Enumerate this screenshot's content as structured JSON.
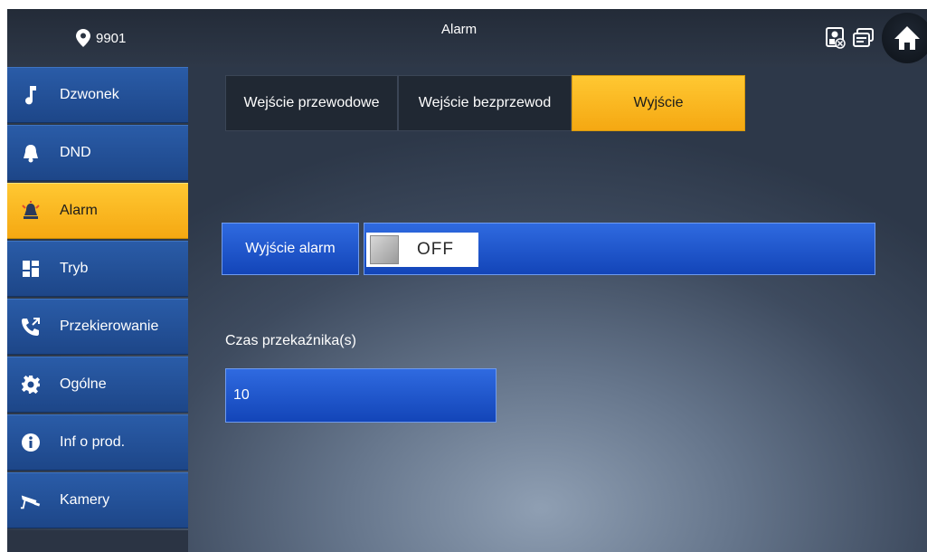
{
  "header": {
    "location_number": "9901",
    "title": "Alarm"
  },
  "sidebar": {
    "items": [
      {
        "label": "Dzwonek",
        "icon": "music-note-icon",
        "active": false
      },
      {
        "label": "DND",
        "icon": "bell-icon",
        "active": false
      },
      {
        "label": "Alarm",
        "icon": "alarm-bell-icon",
        "active": true
      },
      {
        "label": "Tryb",
        "icon": "grid-icon",
        "active": false
      },
      {
        "label": "Przekierowanie",
        "icon": "phone-forward-icon",
        "active": false
      },
      {
        "label": "Ogólne",
        "icon": "gear-icon",
        "active": false
      },
      {
        "label": "Inf o prod.",
        "icon": "info-icon",
        "active": false
      },
      {
        "label": "Kamery",
        "icon": "camera-icon",
        "active": false
      }
    ]
  },
  "tabs": [
    {
      "label": "Wejście przewodowe",
      "active": false
    },
    {
      "label": "Wejście bezprzewod",
      "active": false
    },
    {
      "label": "Wyjście",
      "active": true
    }
  ],
  "alarm_output": {
    "label": "Wyjście alarm",
    "state": "OFF"
  },
  "relay_time": {
    "label": "Czas przekaźnika(s)",
    "value": "10"
  },
  "colors": {
    "accent_active": "#f5a812",
    "nav_blue": "#1d4688",
    "field_blue": "#1345b8"
  }
}
